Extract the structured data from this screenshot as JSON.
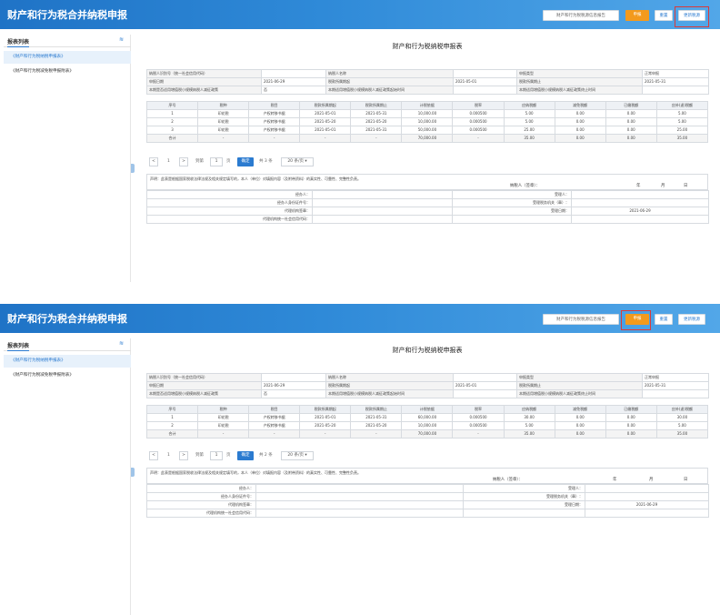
{
  "header": {
    "title": "财产和行为税合并纳税申报",
    "btn_template": "财产和行为税税源信息报告",
    "btn_declare": "申报",
    "btn_reset": "重置",
    "btn_update": "更新税源"
  },
  "sidebar": {
    "title": "报表列表",
    "items": [
      "《财产和行为税纳税申报表》",
      "《财产和行为税减免税申报附表》"
    ]
  },
  "form": {
    "title": "财产和行为税纳税申报表",
    "info": {
      "taxpayer_id_label": "纳税人识别号（统一社会信用代码）",
      "taxpayer_id_value": "",
      "taxpayer_name_label": "纳税人名称",
      "taxpayer_name_value": "",
      "declare_type_label": "申报类型",
      "declare_type_value": "正常申报",
      "declare_date_label": "申报日期",
      "declare_date_value": "2021-06-29",
      "period_start_label": "税款所属期起",
      "period_start_value": "2021-05-01",
      "period_end_label": "税款所属期止",
      "period_end_value": "2021-05-31",
      "small_scale_label": "本期是否适用增值税小规模纳税人减征政策",
      "small_scale_value": "否",
      "small_start_label": "本期适用增值税小规模纳税人减征政策起始时间",
      "small_start_value": "",
      "small_end_label": "本期适用增值税小规模纳税人减征政策终止时间",
      "small_end_value": ""
    },
    "columns": [
      "序号",
      "税种",
      "税目",
      "税款所属期起",
      "税款所属期止",
      "计税依据",
      "税率",
      "应纳税额",
      "减免税额",
      "已缴税额",
      "应补(退)税额"
    ]
  },
  "panel1": {
    "rows": [
      [
        "1",
        "印花税",
        "产权转移书据",
        "2021-05-01",
        "2021-05-31",
        "10,000.00",
        "0.000500",
        "5.00",
        "0.00",
        "0.00",
        "5.00"
      ],
      [
        "2",
        "印花税",
        "产权转移书据",
        "2021-05-20",
        "2021-05-20",
        "10,000.00",
        "0.000500",
        "5.00",
        "0.00",
        "0.00",
        "5.00"
      ],
      [
        "3",
        "印花税",
        "产权转移书据",
        "2021-05-01",
        "2021-05-31",
        "50,000.00",
        "0.000500",
        "25.00",
        "0.00",
        "0.00",
        "25.00"
      ]
    ],
    "total": [
      "合计",
      "-",
      "-",
      "-",
      "-",
      "70,000.00",
      "-",
      "35.00",
      "0.00",
      "0.00",
      "35.00"
    ],
    "pager": {
      "prev": "<",
      "page": "1",
      "next": ">",
      "goto": "到第",
      "page_input": "1",
      "page_unit": "页",
      "go": "确定",
      "total": "共 3 条",
      "per_page": "20 条/页 ▾"
    }
  },
  "panel2": {
    "rows": [
      [
        "1",
        "印花税",
        "产权转移书据",
        "2021-05-01",
        "2021-05-31",
        "60,000.00",
        "0.000500",
        "30.00",
        "0.00",
        "0.00",
        "30.00"
      ],
      [
        "2",
        "印花税",
        "产权转移书据",
        "2021-05-20",
        "2021-05-20",
        "10,000.00",
        "0.000500",
        "5.00",
        "0.00",
        "0.00",
        "5.00"
      ]
    ],
    "total": [
      "合计",
      "-",
      "-",
      "-",
      "-",
      "70,000.00",
      "-",
      "35.00",
      "0.00",
      "0.00",
      "35.00"
    ],
    "pager": {
      "prev": "<",
      "page": "1",
      "next": ">",
      "goto": "到第",
      "page_input": "1",
      "page_unit": "页",
      "go": "确定",
      "total": "共 2 条",
      "per_page": "20 条/页 ▾"
    }
  },
  "declaration": {
    "statement": "声明：此表是根据国家税收法律法规及相关规定填写的，本人（单位）对填报内容（及附带资料）的真实性、可靠性、完整性负责。",
    "signer": "纳税人（签章）：",
    "year": "年",
    "month": "月",
    "day": "日",
    "operator_label": "经办人：",
    "operator_id_label": "经办人身份证件号：",
    "operator_id_value": "",
    "agent_org_label": "代理机构签章：",
    "agent_org_code_label": "代理机构统一社会信用代码：",
    "receiver_label": "受理人：",
    "tax_office_label": "受理税务机关（章）：",
    "receive_date_label": "受理日期：",
    "receive_date_value": "2021-06-29"
  }
}
